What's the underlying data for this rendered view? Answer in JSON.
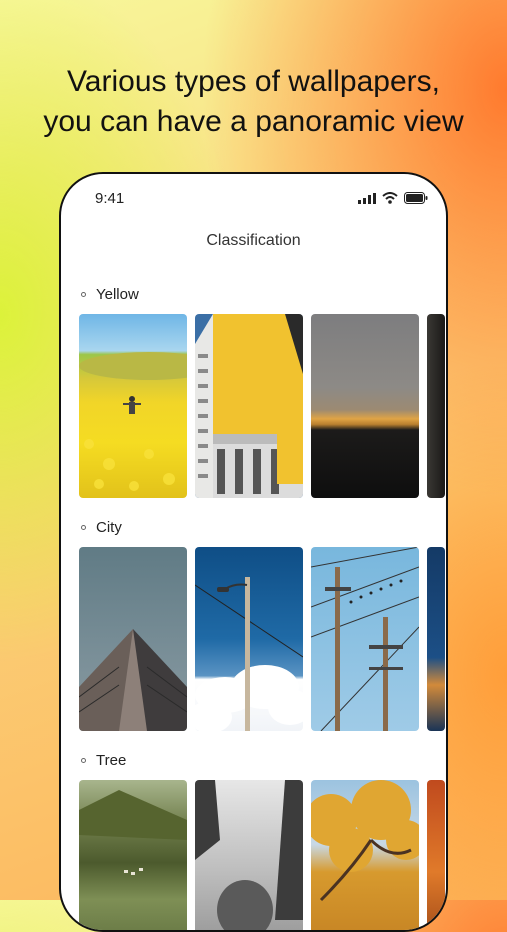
{
  "headline": {
    "line1": "Various types of wallpapers,",
    "line2": "you can have a panoramic view"
  },
  "status_bar": {
    "time": "9:41"
  },
  "nav": {
    "title": "Classification"
  },
  "sections": [
    {
      "label": "Yellow",
      "images": [
        "rapeseed-field-person",
        "yellow-apartment-building",
        "sunset-horizon",
        "dark-window"
      ]
    },
    {
      "label": "City",
      "images": [
        "skyscraper-looking-up",
        "streetlight-and-clouds",
        "power-poles-with-birds",
        "city-lights-partial"
      ]
    },
    {
      "label": "Tree",
      "images": [
        "mountain-valley-village",
        "misty-forest",
        "autumn-tree",
        "autumn-leaves-partial"
      ]
    }
  ]
}
